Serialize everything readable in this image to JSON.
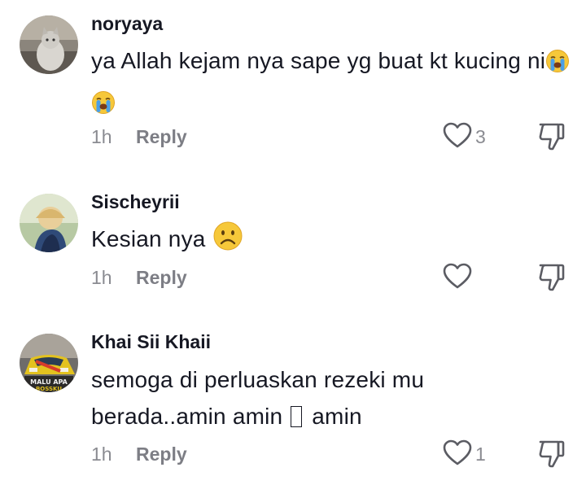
{
  "comments": [
    {
      "username": "noryaya",
      "text": "ya Allah kejam nya sape yg buat kt kucing ni",
      "emoji": [
        "loudly-crying-face",
        "loudly-crying-face"
      ],
      "time": "1h",
      "reply_label": "Reply",
      "like_count": "3"
    },
    {
      "username": "Sischeyrii",
      "text": "Kesian nya",
      "emoji": [
        "frowning-face"
      ],
      "time": "1h",
      "reply_label": "Reply",
      "like_count": ""
    },
    {
      "username": "Khai Sii Khaii",
      "text_line1": "semoga di perluaskan rezeki mu",
      "text_line2_a": "berada..amin amin",
      "text_line2_b": "amin",
      "avatar_text_1": "MALU APA",
      "avatar_text_2": "BOSSKU",
      "time": "1h",
      "reply_label": "Reply",
      "like_count": "1"
    }
  ],
  "colors": {
    "text": "#161823",
    "meta": "#8a8b91",
    "icon": "#5b5c63",
    "emoji_yellow": "#f6c83a",
    "emoji_tear": "#4a9fe8"
  }
}
